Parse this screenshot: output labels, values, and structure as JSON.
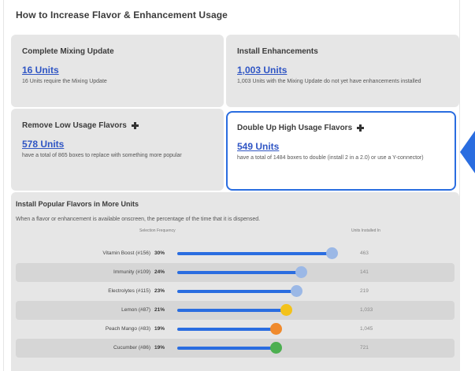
{
  "header": {
    "title": "How to Increase Flavor & Enhancement Usage"
  },
  "cards": {
    "mixing": {
      "title": "Complete Mixing Update",
      "link": "16 Units",
      "desc": "16 Units require the Mixing Update"
    },
    "install": {
      "title": "Install Enhancements",
      "link": "1,003 Units",
      "desc": "1,003 Units with the Mixing Update do not yet have enhancements installed"
    },
    "remove": {
      "title": "Remove Low Usage Flavors",
      "link": "578 Units",
      "desc": "have a total of 865 boxes to replace with something more popular"
    },
    "double": {
      "title": "Double Up High Usage Flavors",
      "link": "549 Units",
      "desc": "have a total of 1484 boxes to double (install 2 in a 2.0) or use a Y-connector)"
    }
  },
  "popular": {
    "title": "Install Popular Flavors in More Units",
    "desc": "When a flavor or enhancement is available onscreen, the percentage of the time that it is dispensed.",
    "col_freq": "Selection Frequency",
    "col_units": "Units Installed In",
    "rows": [
      {
        "name": "Vitamin Boost (#156)",
        "pct": "30%",
        "value": 30,
        "units": "463",
        "icon": "vitamin-boost-icon",
        "color": "#9bb8e6"
      },
      {
        "name": "Immunity (#109)",
        "pct": "24%",
        "value": 24,
        "units": "141",
        "icon": "immunity-icon",
        "color": "#9bb8e6"
      },
      {
        "name": "Electrolytes (#115)",
        "pct": "23%",
        "value": 23,
        "units": "219",
        "icon": "electrolytes-icon",
        "color": "#9bb8e6"
      },
      {
        "name": "Lemon (#87)",
        "pct": "21%",
        "value": 21,
        "units": "1,033",
        "icon": "lemon-icon",
        "color": "#f3c21a"
      },
      {
        "name": "Peach Mango (#83)",
        "pct": "19%",
        "value": 19,
        "units": "1,045",
        "icon": "peach-mango-icon",
        "color": "#f08a2c"
      },
      {
        "name": "Cucumber (#86)",
        "pct": "19%",
        "value": 19,
        "units": "721",
        "icon": "cucumber-icon",
        "color": "#4caf50"
      }
    ]
  }
}
